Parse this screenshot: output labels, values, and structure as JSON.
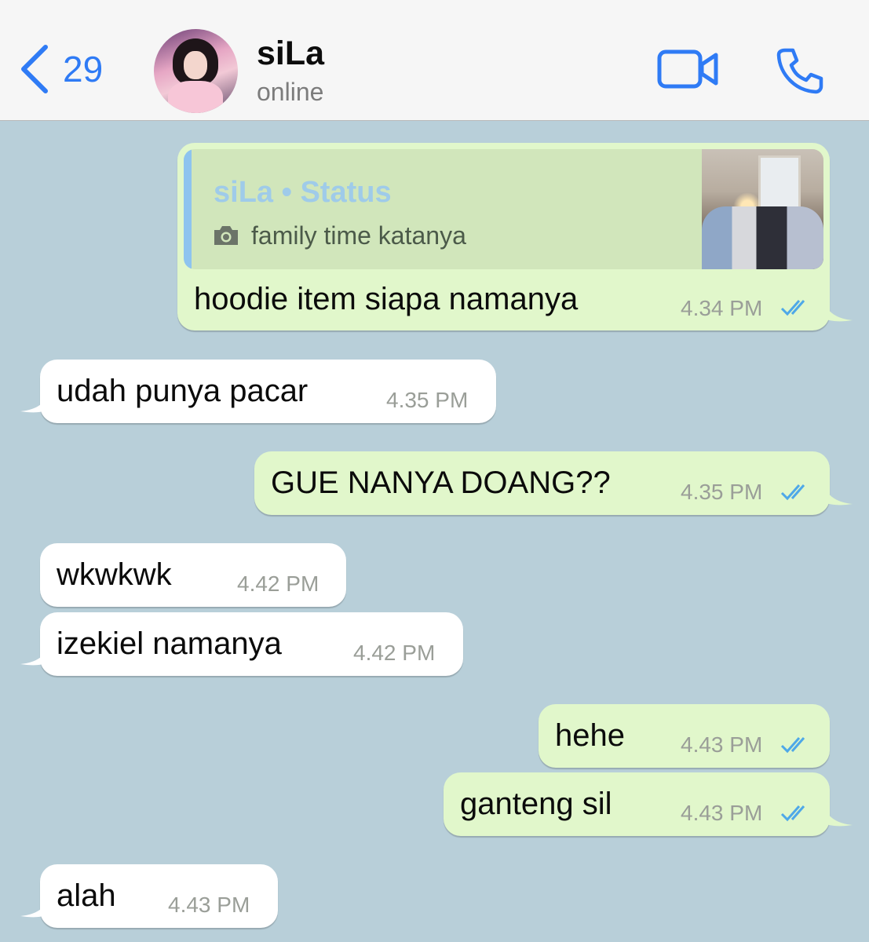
{
  "header": {
    "back_count": "29",
    "contact_name": "siLa",
    "contact_status": "online"
  },
  "colors": {
    "accent": "#2f7bf5",
    "chat_background": "#b8cfd9",
    "outgoing_bubble": "#e1f7cb",
    "incoming_bubble": "#ffffff",
    "read_ticks": "#4ea8e8"
  },
  "icons": {
    "back": "chevron-left-icon",
    "video": "video-camera-icon",
    "call": "phone-icon",
    "read": "double-check-icon",
    "status_photo": "camera-icon"
  },
  "messages": [
    {
      "direction": "out",
      "quote": {
        "title": "siLa • Status",
        "caption": "family time katanya"
      },
      "text": "hoodie item siapa namanya",
      "time": "4.34 PM",
      "read": true
    },
    {
      "direction": "in",
      "text": "udah punya pacar",
      "time": "4.35 PM"
    },
    {
      "direction": "out",
      "text": "GUE NANYA DOANG??",
      "time": "4.35 PM",
      "read": true
    },
    {
      "direction": "in",
      "text": "wkwkwk",
      "time": "4.42 PM"
    },
    {
      "direction": "in",
      "text": "izekiel namanya",
      "time": "4.42 PM"
    },
    {
      "direction": "out",
      "text": "hehe",
      "time": "4.43 PM",
      "read": true
    },
    {
      "direction": "out",
      "text": "ganteng sil",
      "time": "4.43 PM",
      "read": true
    },
    {
      "direction": "in",
      "text": "alah",
      "time": "4.43 PM"
    }
  ]
}
